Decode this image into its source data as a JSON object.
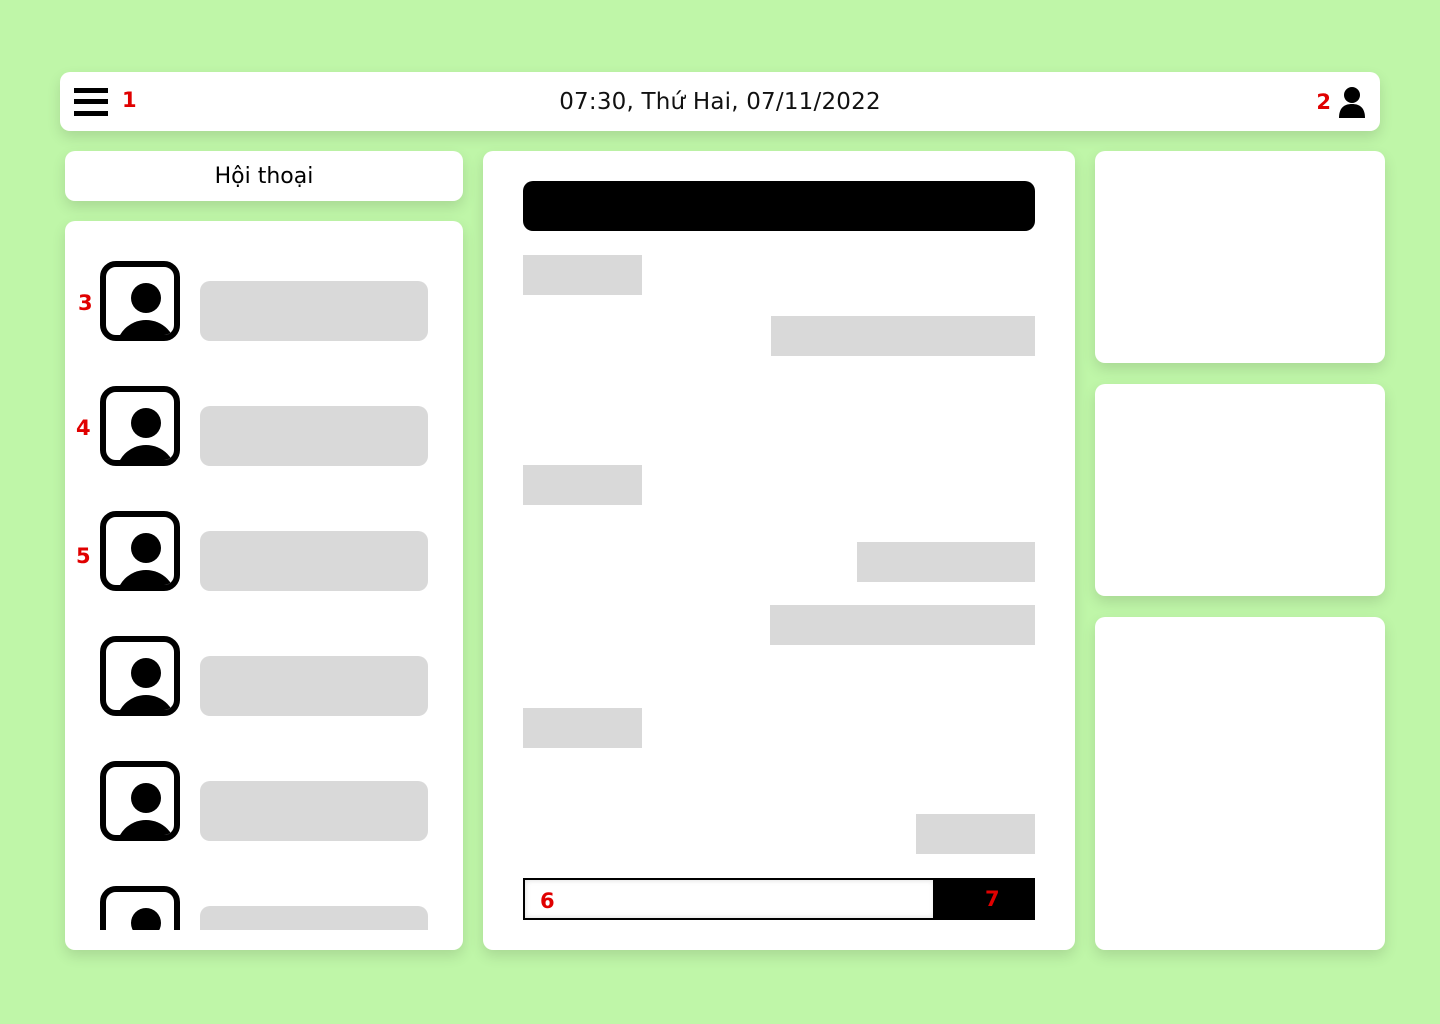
{
  "topbar": {
    "datetime": "07:30, Thứ Hai, 07/11/2022",
    "menu_icon": "hamburger-menu-icon",
    "user_icon": "user-icon"
  },
  "sidebar": {
    "header": "Hội thoại",
    "items": [
      {
        "avatar_icon": "avatar-icon"
      },
      {
        "avatar_icon": "avatar-icon"
      },
      {
        "avatar_icon": "avatar-icon"
      },
      {
        "avatar_icon": "avatar-icon"
      },
      {
        "avatar_icon": "avatar-icon"
      },
      {
        "avatar_icon": "avatar-icon"
      }
    ]
  },
  "markers": {
    "menu": "1",
    "user": "2",
    "conv1": "3",
    "conv2": "4",
    "conv3": "5",
    "input": "6",
    "send": "7"
  },
  "colors": {
    "background": "#bff6a8",
    "card": "#ffffff",
    "placeholder": "#d9d9d9",
    "marker": "#e00000",
    "ink": "#000000"
  }
}
